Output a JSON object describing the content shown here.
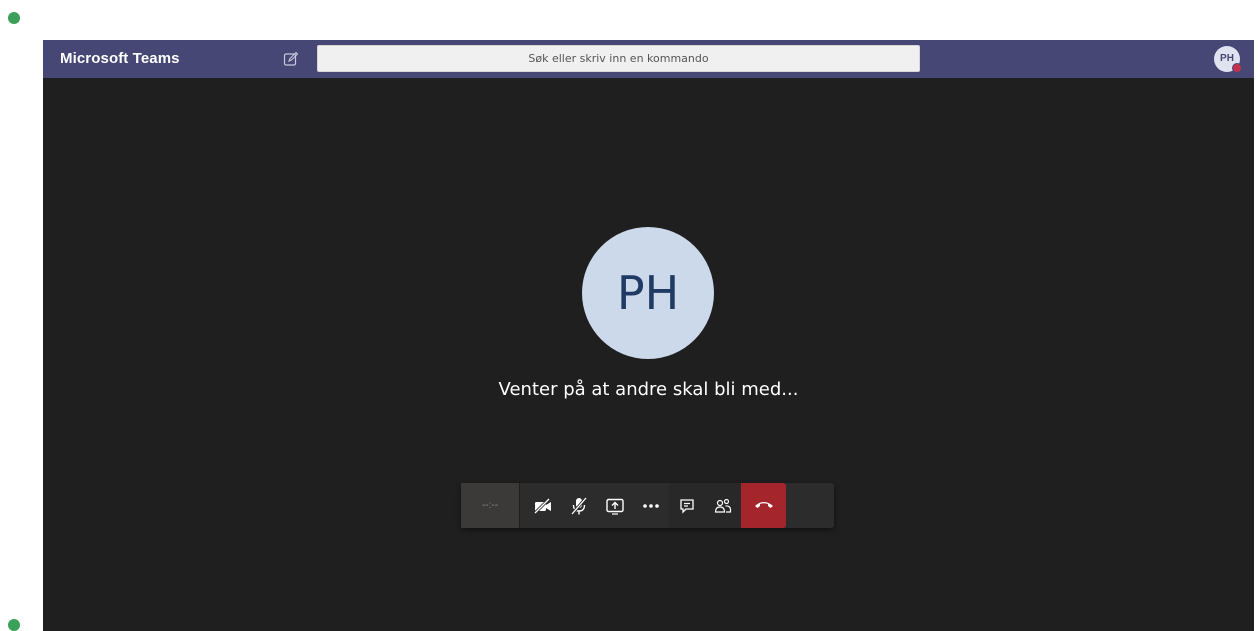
{
  "app": {
    "title": "Microsoft Teams"
  },
  "search": {
    "placeholder": "Søk eller skriv inn en kommando"
  },
  "profile": {
    "initials": "PH",
    "presence_color": "#c4314b"
  },
  "call": {
    "avatar_initials": "PH",
    "status_text": "Venter på at andre skal bli med...",
    "timer": "--:--"
  },
  "controls": [
    {
      "name": "camera-off",
      "icon": "camera-off-icon"
    },
    {
      "name": "mic-off",
      "icon": "mic-off-icon"
    },
    {
      "name": "share-screen",
      "icon": "share-screen-icon"
    },
    {
      "name": "more-actions",
      "icon": "more-icon"
    },
    {
      "name": "chat",
      "icon": "chat-icon"
    },
    {
      "name": "participants",
      "icon": "participants-icon"
    },
    {
      "name": "hang-up",
      "icon": "hang-up-icon"
    }
  ],
  "colors": {
    "titlebar": "#464775",
    "stage": "#1f1f1f",
    "hangup": "#a4262c",
    "avatar_bg": "#cbd9eb"
  }
}
